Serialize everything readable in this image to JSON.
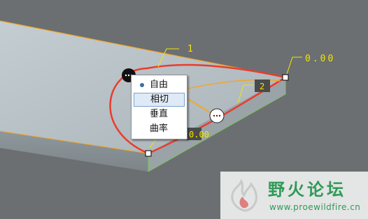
{
  "viewport": {
    "dimension_top_right": "0.00",
    "dimension_top": "1",
    "dimension_box_right": "2",
    "dimension_box_left": "0.00"
  },
  "context_menu": {
    "items": [
      {
        "label": "自由",
        "selected": true
      },
      {
        "label": "相切",
        "highlighted": true
      },
      {
        "label": "垂直"
      },
      {
        "label": "曲率"
      }
    ]
  },
  "watermark": {
    "title": "野火论坛",
    "url": "www.proewildfire.cn"
  },
  "colors": {
    "background": "#6b6f72",
    "face": "#b6c0c5",
    "edge_orange": "#f5a623",
    "curve_red": "#ea3c2c",
    "dimension_yellow": "#f2e600",
    "watermark_green": "#2f9a57"
  }
}
